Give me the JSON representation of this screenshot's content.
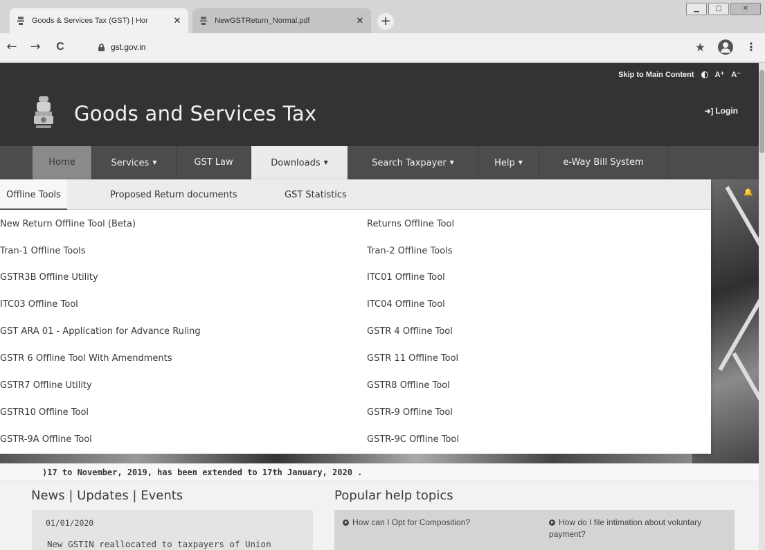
{
  "browser": {
    "tabs": [
      {
        "title": "Goods & Services Tax (GST) | Hor",
        "active": true
      },
      {
        "title": "NewGSTReturn_Normal.pdf",
        "active": false
      }
    ],
    "new_tab_label": "+",
    "url": "gst.gov.in",
    "nav": {
      "back": "←",
      "forward": "→",
      "reload": "C"
    }
  },
  "header": {
    "skip_link": "Skip to Main Content",
    "font_increase": "A⁺",
    "font_decrease": "A⁻",
    "site_name": "Goods and Services Tax",
    "login": "Login"
  },
  "mainnav": [
    {
      "label": "Home",
      "has_caret": false
    },
    {
      "label": "Services",
      "has_caret": true
    },
    {
      "label": "GST Law",
      "has_caret": false
    },
    {
      "label": "Downloads",
      "has_caret": true
    },
    {
      "label": "Search Taxpayer",
      "has_caret": true
    },
    {
      "label": "Help",
      "has_caret": true
    },
    {
      "label": "e-Way Bill System",
      "has_caret": false
    }
  ],
  "dropdown": {
    "tabs": [
      "Offline Tools",
      "Proposed Return documents",
      "GST Statistics"
    ],
    "left_links": [
      "New Return Offline Tool (Beta)",
      "Tran-1 Offline Tools",
      "GSTR3B Offline Utility",
      "ITC03 Offline Tool",
      "GST ARA 01 - Application for Advance Ruling",
      "GSTR 6 Offline Tool With Amendments",
      "GSTR7 Offline Utility",
      "GSTR10 Offline Tool",
      "GSTR-9A Offline Tool"
    ],
    "right_links": [
      "Returns Offline Tool",
      "Tran-2 Offline Tools",
      "ITC01 Offline Tool",
      "ITC04 Offline Tool",
      "GSTR 4 Offline Tool",
      "GSTR 11 Offline Tool",
      "GSTR8 Offline Tool",
      "GSTR-9 Offline Tool",
      "GSTR-9C Offline Tool"
    ]
  },
  "ticker": ")17 to November, 2019, has been extended to 17th January, 2020 .",
  "news": {
    "heading": "News | Updates | Events",
    "date": "01/01/2020",
    "text": "New GSTIN reallocated to taxpayers of Union"
  },
  "help": {
    "heading": "Popular help topics",
    "items": [
      "How can I Opt for Composition?",
      "How do I file intimation about voluntary payment?"
    ]
  }
}
